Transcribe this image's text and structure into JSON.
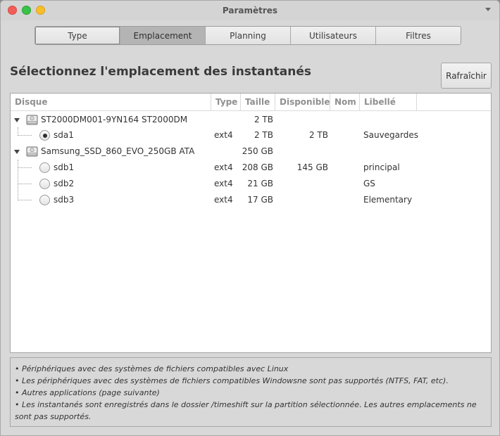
{
  "window": {
    "title": "Paramètres"
  },
  "tabs": [
    {
      "label": "Type"
    },
    {
      "label": "Emplacement"
    },
    {
      "label": "Planning"
    },
    {
      "label": "Utilisateurs"
    },
    {
      "label": "Filtres"
    }
  ],
  "main": {
    "heading": "Sélectionnez l'emplacement des instantanés",
    "refresh_label": "Rafraîchir"
  },
  "table": {
    "columns": [
      "Disque",
      "Type",
      "Taille",
      "Disponible",
      "Nom",
      "Libellé"
    ],
    "rows": [
      {
        "kind": "disk",
        "name": "ST2000DM001-9YN164 ST2000DM",
        "type": "",
        "size": "2 TB",
        "free": "",
        "label_name": "",
        "label": ""
      },
      {
        "kind": "partition",
        "selected": true,
        "name": "sda1",
        "type": "ext4",
        "size": "2 TB",
        "free": "2 TB",
        "label_name": "",
        "label": "Sauvegardes"
      },
      {
        "kind": "disk",
        "name": "Samsung_SSD_860_EVO_250GB ATA",
        "type": "",
        "size": "250 GB",
        "free": "",
        "label_name": "",
        "label": ""
      },
      {
        "kind": "partition",
        "selected": false,
        "name": "sdb1",
        "type": "ext4",
        "size": "208 GB",
        "free": "145 GB",
        "label_name": "",
        "label": "principal"
      },
      {
        "kind": "partition",
        "selected": false,
        "name": "sdb2",
        "type": "ext4",
        "size": "21 GB",
        "free": "",
        "label_name": "",
        "label": "GS"
      },
      {
        "kind": "partition",
        "selected": false,
        "name": "sdb3",
        "type": "ext4",
        "size": "17 GB",
        "free": "",
        "label_name": "",
        "label": "Elementary"
      }
    ]
  },
  "info": {
    "lines": [
      "• Périphériques avec des systèmes de fichiers compatibles avec Linux",
      "• Les périphériques avec des systèmes de fichiers compatibles Windowsne sont pas supportés (NTFS, FAT, etc).",
      "• Autres applications (page suivante)",
      "• Les instantanés sont enregistrés dans le dossier /timeshift sur la partition sélectionnée. Les autres emplacements ne sont pas supportés."
    ]
  },
  "icons": {
    "disk": "hard-disk-icon",
    "expander": "triangle-down-icon",
    "menu": "chevron-down-icon"
  },
  "colors": {
    "traffic_close": "#f25d57",
    "traffic_min": "#38c246",
    "traffic_max": "#f6be2a",
    "active_tab": "#b4b4b4"
  }
}
